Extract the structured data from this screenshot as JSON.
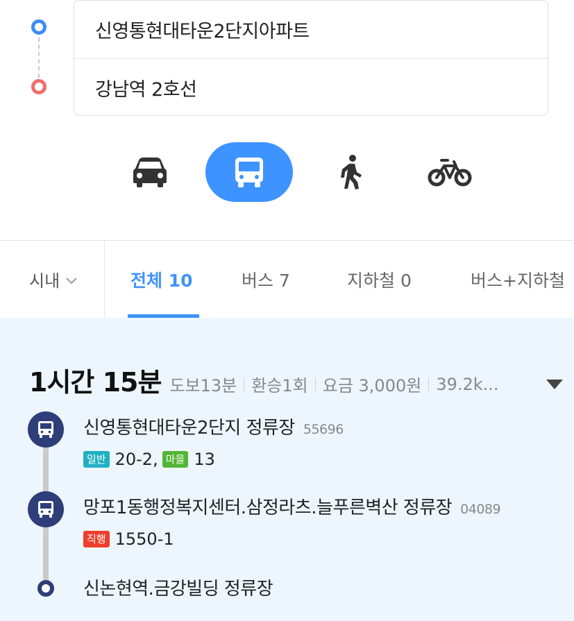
{
  "route": {
    "origin": "신영통현대타운2단지아파트",
    "destination": "강남역 2호선"
  },
  "modes": [
    {
      "name": "car-icon"
    },
    {
      "name": "bus-icon",
      "active": true
    },
    {
      "name": "walk-icon"
    },
    {
      "name": "bike-icon"
    }
  ],
  "tabs": {
    "filter_label": "시내",
    "items": [
      {
        "label": "전체 10",
        "active": true
      },
      {
        "label": "버스 7"
      },
      {
        "label": "지하철 0"
      },
      {
        "label": "버스+지하철"
      }
    ]
  },
  "result": {
    "duration": "1시간 15분",
    "walk": "도보13분",
    "transfers": "환승1회",
    "fare": "요금 3,000원",
    "distance": "39.2k...",
    "stops": [
      {
        "name": "신영통현대타운2단지 정류장",
        "code": "55696",
        "lines": [
          {
            "badge": "일반",
            "badge_color": "#20b0c4",
            "number": "20-2,"
          },
          {
            "badge": "마을",
            "badge_color": "#52b536",
            "number": "13"
          }
        ]
      },
      {
        "name": "망포1동행정복지센터.삼정라츠.늘푸른벽산 정류장",
        "code": "04089",
        "lines": [
          {
            "badge": "직행",
            "badge_color": "#ee3e2c",
            "number": "1550-1"
          }
        ]
      },
      {
        "name": "신논현역.금강빌딩 정류장"
      }
    ]
  },
  "colors": {
    "accent": "#3d93ff",
    "stop_icon": "#2d3e78",
    "origin_dot": "#3d8bfd",
    "destination_dot": "#f26b6b"
  }
}
